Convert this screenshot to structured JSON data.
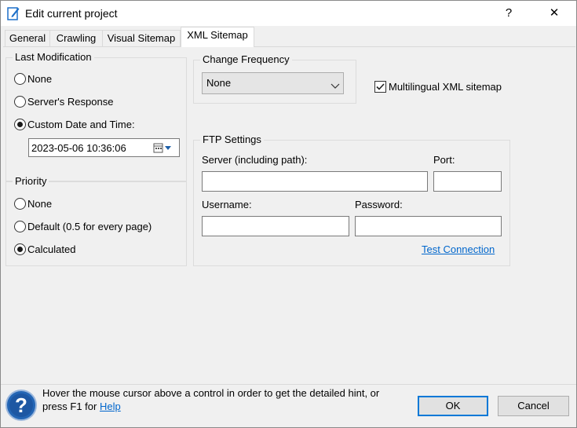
{
  "window": {
    "title": "Edit current project",
    "help_glyph": "?",
    "close_glyph": "✕"
  },
  "tabs": [
    {
      "label": "General"
    },
    {
      "label": "Crawling"
    },
    {
      "label": "Visual Sitemap"
    },
    {
      "label": "XML Sitemap",
      "active": true
    }
  ],
  "last_modification": {
    "title": "Last Modification",
    "options": [
      "None",
      "Server's Response",
      "Custom Date and Time:"
    ],
    "selected": "Custom Date and Time:",
    "datetime_value": "2023-05-06 10:36:06"
  },
  "priority": {
    "title": "Priority",
    "options": [
      "None",
      "Default (0.5 for every page)",
      "Calculated"
    ],
    "selected": "Calculated"
  },
  "change_frequency": {
    "title": "Change Frequency",
    "selected_value": "None"
  },
  "multilingual": {
    "label": "Multilingual XML sitemap",
    "checked": true
  },
  "ftp": {
    "title": "FTP Settings",
    "server_label": "Server (including path):",
    "port_label": "Port:",
    "username_label": "Username:",
    "password_label": "Password:",
    "server_value": "",
    "port_value": "",
    "username_value": "",
    "password_value": "",
    "test_link": "Test Connection"
  },
  "footer": {
    "hint_text": "Hover the mouse cursor above a control in order to get the detailed hint, or",
    "hint_text2": "press F1 for",
    "help_link": "Help",
    "ok_label": "OK",
    "cancel_label": "Cancel"
  },
  "colors": {
    "accent": "#0078d7",
    "link": "#0066cc",
    "panel_bg": "#f0f0f0"
  }
}
